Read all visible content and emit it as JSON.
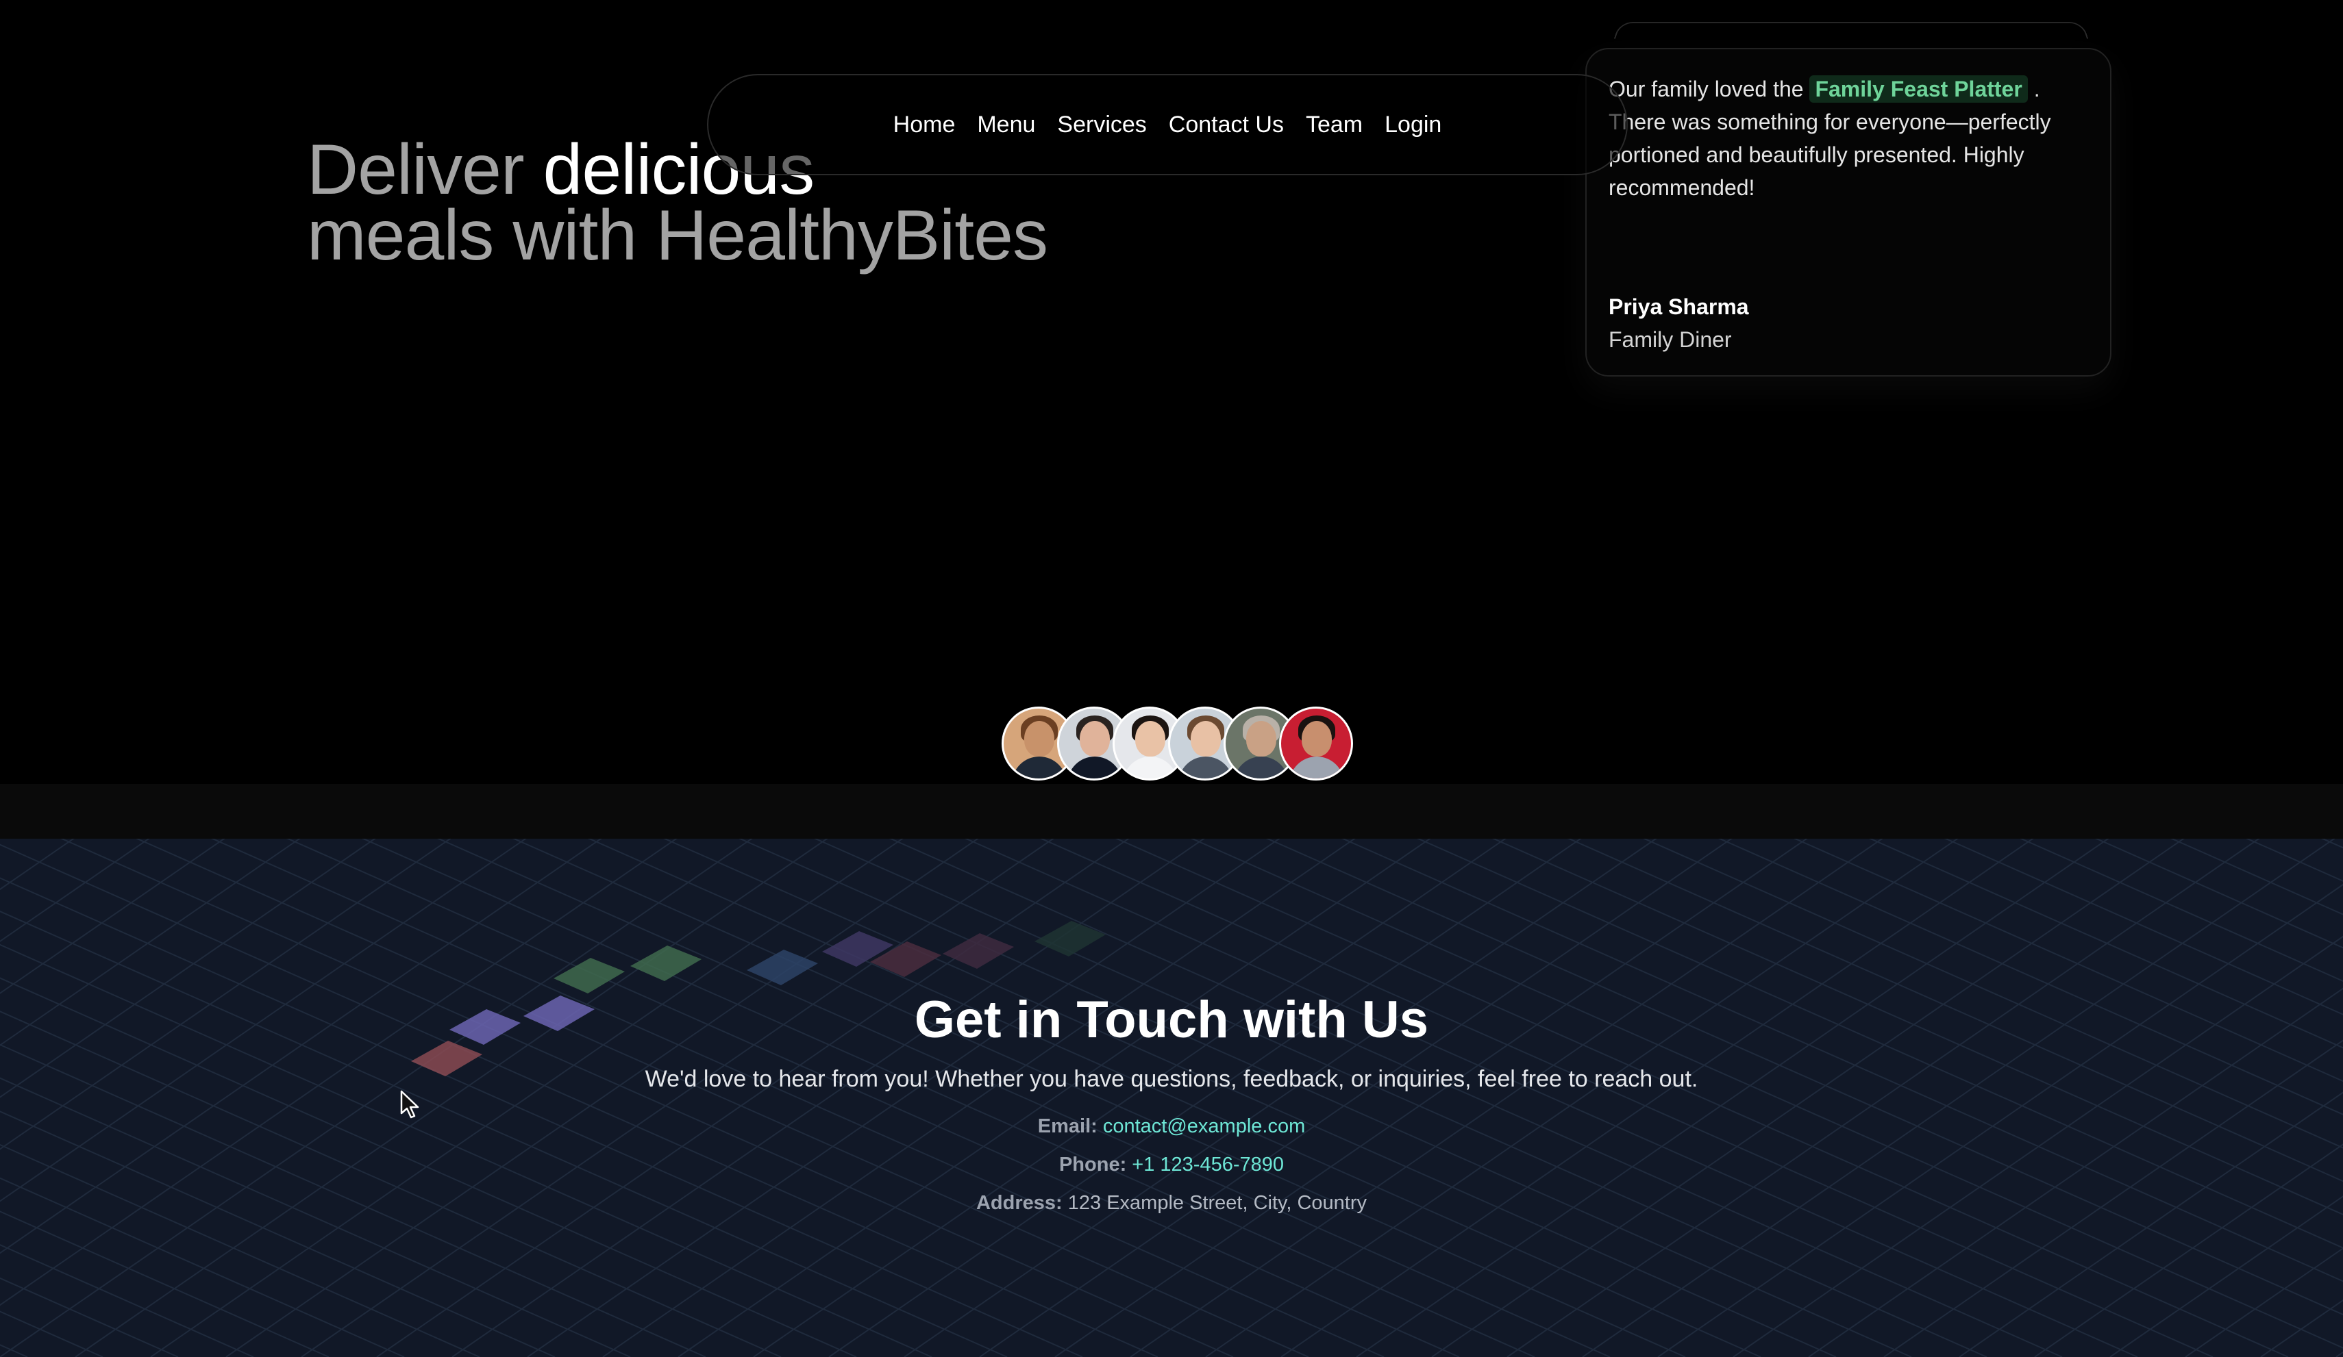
{
  "nav": {
    "items": [
      "Home",
      "Menu",
      "Services",
      "Contact Us",
      "Team",
      "Login"
    ]
  },
  "hero": {
    "title_words": [
      {
        "text": "Deliver",
        "emphasis": false
      },
      {
        "text": "delicious",
        "emphasis": true
      },
      {
        "text": "meals",
        "emphasis": false
      },
      {
        "text": "with",
        "emphasis": false
      },
      {
        "text": "HealthyBites",
        "emphasis": false
      }
    ]
  },
  "testimonial": {
    "quote_before": "Our family loved the",
    "highlight": "Family Feast Platter",
    "quote_after": ". There was something for everyone—perfectly portioned and beautifully presented. Highly recommended!",
    "author": "Priya Sharma",
    "role": "Family Diner"
  },
  "avatars": [
    {
      "name": "avatar-1",
      "skin": "#c8926a",
      "hair": "#6b3f22",
      "shirt": "#1f2937",
      "bg": "#d6a57a"
    },
    {
      "name": "avatar-2",
      "skin": "#e0b39a",
      "hair": "#2a2320",
      "shirt": "#111827",
      "bg": "#cfd4da"
    },
    {
      "name": "avatar-3",
      "skin": "#e9c2a6",
      "hair": "#1b1411",
      "shirt": "#f3f4f6",
      "bg": "#e5e7eb"
    },
    {
      "name": "avatar-4",
      "skin": "#e8c1a5",
      "hair": "#6b4a32",
      "shirt": "#4b5563",
      "bg": "#c9d2da"
    },
    {
      "name": "avatar-5",
      "skin": "#c9a185",
      "hair": "#b9b1a8",
      "shirt": "#374151",
      "bg": "#6b7568"
    },
    {
      "name": "avatar-6",
      "skin": "#c88f6e",
      "hair": "#1a1210",
      "shirt": "#9ca3af",
      "bg": "#c81e32"
    }
  ],
  "contact": {
    "title": "Get in Touch with Us",
    "subtitle": "We'd love to hear from you! Whether you have questions, feedback, or inquiries, feel free to reach out.",
    "email_label": "Email:",
    "email": "contact@example.com",
    "phone_label": "Phone:",
    "phone": "+1 123-456-7890",
    "address_label": "Address:",
    "address": "123 Example Street, City, Country"
  },
  "colors": {
    "page_bg": "#000000",
    "contact_bg": "#111827",
    "accent_green": "#6fd49a",
    "link_teal": "#6ee7d6"
  }
}
